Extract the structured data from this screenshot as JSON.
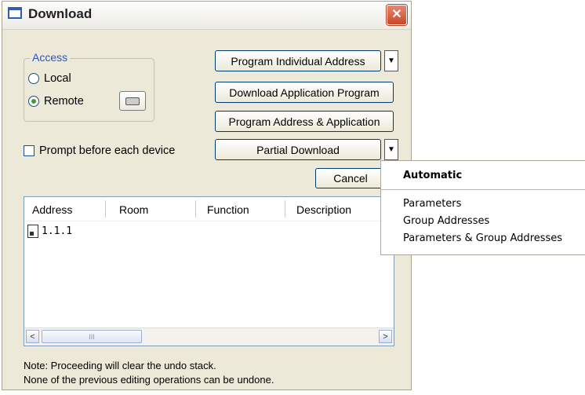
{
  "window": {
    "title": "Download",
    "close": "✕"
  },
  "access": {
    "legend": "Access",
    "local_label": "Local",
    "remote_label": "Remote",
    "selected": "Remote"
  },
  "buttons": {
    "program_individual_address": "Program Individual Address",
    "download_application_program": "Download Application Program",
    "program_address_application": "Program Address & Application",
    "partial_download": "Partial Download",
    "cancel": "Cancel"
  },
  "prompt_checkbox": {
    "label": "Prompt before each device",
    "checked": false
  },
  "table": {
    "columns": [
      "Address",
      "Room",
      "Function",
      "Description"
    ],
    "rows": [
      {
        "address": "1.1.1"
      }
    ]
  },
  "scrollbar": {
    "left": "<",
    "right": ">",
    "grip": "III"
  },
  "note": {
    "line1": "Note: Proceeding will clear the undo stack.",
    "line2": "None of the previous editing operations can be undone."
  },
  "dropdown_menu": {
    "header": "Automatic",
    "items": [
      "Parameters",
      "Group Addresses",
      "Parameters & Group Addresses"
    ]
  },
  "colors": {
    "legend": "#2b55c4",
    "window_bg": "#ece9d8",
    "close": "#c8482a"
  }
}
